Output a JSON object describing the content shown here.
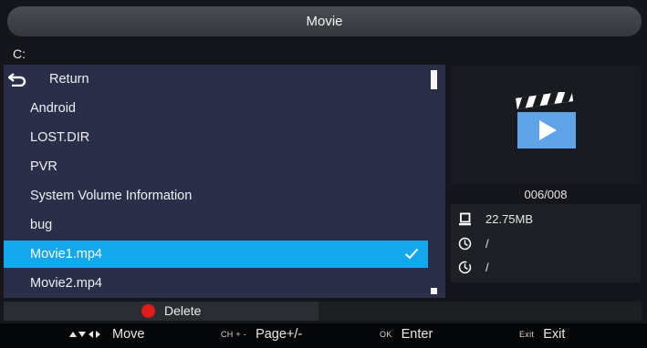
{
  "title": "Movie",
  "path": "C:",
  "file_list": {
    "return_label": "Return",
    "items": [
      "Android",
      "LOST.DIR",
      "PVR",
      "System Volume Information",
      "bug",
      "Movie1.mp4",
      "Movie2.mp4"
    ],
    "selected_index": 5
  },
  "counter": "006/008",
  "file_info": {
    "size": "22.75MB",
    "duration": "/",
    "date": "/"
  },
  "delete_label": "Delete",
  "help": {
    "move_label": "Move",
    "page_key": "CH + -",
    "page_label": "Page+/-",
    "ok_key": "OK",
    "enter_label": "Enter",
    "exit_key": "Exit",
    "exit_label": "Exit"
  },
  "colors": {
    "selected": "#13a7ee",
    "list_bg": "#2b2e48",
    "delete_dot": "#e21b1b",
    "clapper": "#5fa3e8"
  }
}
